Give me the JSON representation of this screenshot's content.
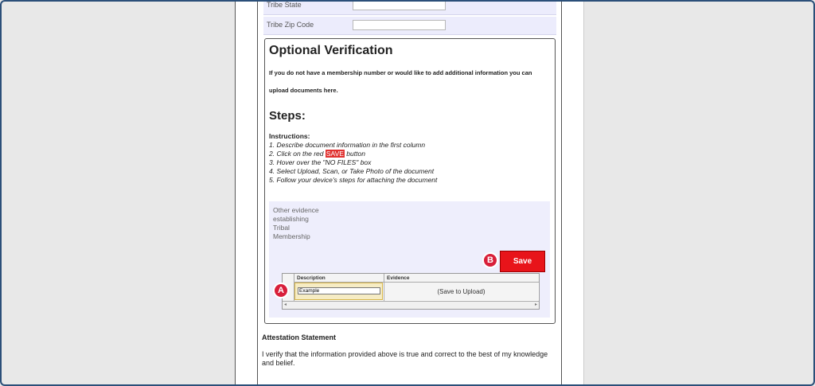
{
  "form": {
    "fields": [
      {
        "label": "Tribe State",
        "value": ""
      },
      {
        "label": "Tribe Zip Code",
        "value": ""
      }
    ]
  },
  "optional_verification": {
    "title": "Optional Verification",
    "intro": "If you do not have a membership number or would like to add additional information you can upload documents here.",
    "steps_title": "Steps:",
    "instructions_heading": "Instructions:",
    "steps": {
      "s1": "1.  Describe document information in the first column",
      "s2_pre": "2.  Click on the red ",
      "s2_highlight": "SAVE",
      "s2_post": " button",
      "s3": "3.  Hover over the \"NO FILES\" box",
      "s4": "4.  Select Upload, Scan, or Take Photo of the document",
      "s5": "5.  Follow your device's steps for attaching the document"
    },
    "panel": {
      "label": "Other evidence establishing Tribal Membership",
      "save_label": "Save",
      "grid": {
        "col_description": "Description",
        "col_evidence": "Evidence",
        "description_value": "Example",
        "evidence_text": "(Save to Upload)"
      }
    }
  },
  "callouts": {
    "a": "A",
    "b": "B"
  },
  "attestation": {
    "heading": "Attestation Statement",
    "body": "I verify that the information provided above is true and correct to the best of my knowledge and belief."
  },
  "colors": {
    "accent": "#e8141a",
    "badge": "#d81f3a",
    "row_bg": "#ececfc"
  }
}
